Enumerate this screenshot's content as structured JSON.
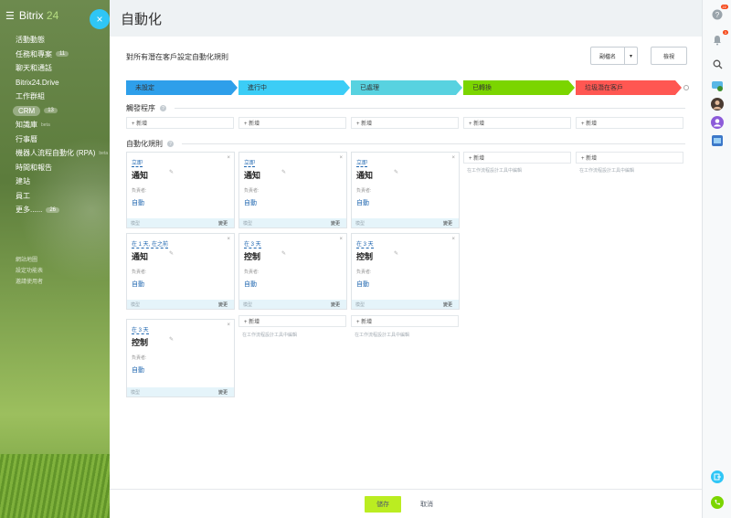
{
  "sidebar": {
    "brand_main": "Bitrix",
    "brand_num": "24",
    "items": [
      {
        "label": "活動動態",
        "badge": ""
      },
      {
        "label": "任務和專案",
        "badge": "11"
      },
      {
        "label": "聊天和通話",
        "badge": ""
      },
      {
        "label": "Bitrix24.Drive",
        "badge": ""
      },
      {
        "label": "工作群組",
        "badge": ""
      },
      {
        "label": "CRM",
        "badge": "13"
      },
      {
        "label": "知識庫",
        "badge": "",
        "sup": "beta"
      },
      {
        "label": "行事曆",
        "badge": ""
      },
      {
        "label": "機器人流程自動化 (RPA)",
        "badge": "",
        "sup": "beta"
      },
      {
        "label": "時間和報告",
        "badge": ""
      },
      {
        "label": "建站",
        "badge": ""
      },
      {
        "label": "員工",
        "badge": ""
      },
      {
        "label": "更多......",
        "badge": "26"
      }
    ],
    "small_items": [
      "網站地圖",
      "設定功能表",
      "邀請使用者"
    ]
  },
  "page": {
    "title": "自動化",
    "heading": "對所有潛在客戶設定自動化規則",
    "rename_btn": "副檔名",
    "view_btn": "檢視",
    "close_glyph": "×"
  },
  "stages": [
    {
      "label": "未設定",
      "color": "#2e9fea"
    },
    {
      "label": "進行中",
      "color": "#3ccdf6"
    },
    {
      "label": "已處理",
      "color": "#58d2e0"
    },
    {
      "label": "已轉換",
      "color": "#7bd500"
    },
    {
      "label": "垃圾潛在客戶",
      "color": "#ff5752"
    }
  ],
  "sections": {
    "triggers_label": "觸發程序",
    "rules_label": "自動化規則"
  },
  "add_label": "+ 新增",
  "hint_text": "在工作流程設計工具中編輯",
  "cards": {
    "responsible_label": "負責者:",
    "responsible_value": "自動",
    "template_label": "模型",
    "change_label": "變更",
    "items": [
      {
        "trigger": "立即",
        "title": "通知"
      },
      {
        "trigger": "立即",
        "title": "通知"
      },
      {
        "trigger": "立即",
        "title": "通知"
      },
      {
        "trigger": "在 1 天, 在之前",
        "title": "通知"
      },
      {
        "trigger": "在 3 天",
        "title": "控制"
      },
      {
        "trigger": "在 3 天",
        "title": "控制"
      },
      {
        "trigger": "在 3 天",
        "title": "控制"
      }
    ]
  },
  "footer": {
    "save": "儲存",
    "cancel": "取消"
  },
  "rightbar": {
    "help_badge": "22",
    "bell_badge": "3"
  },
  "colors": {
    "accent": "#2fc6f6",
    "save": "#bbed21",
    "link": "#2067b0"
  }
}
